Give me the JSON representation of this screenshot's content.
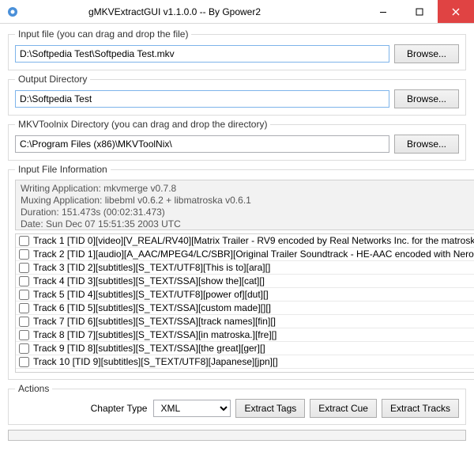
{
  "window": {
    "title": "gMKVExtractGUI v1.1.0.0 -- By Gpower2"
  },
  "input_file": {
    "legend": "Input file (you can drag and drop the file)",
    "value": "D:\\Softpedia Test\\Softpedia Test.mkv",
    "browse": "Browse..."
  },
  "output_dir": {
    "legend": "Output Directory",
    "value": "D:\\Softpedia Test",
    "browse": "Browse..."
  },
  "toolnix_dir": {
    "legend": "MKVToolnix Directory (you can drag and drop the directory)",
    "value": "C:\\Program Files (x86)\\MKVToolNix\\",
    "browse": "Browse..."
  },
  "file_info": {
    "legend": "Input File Information",
    "text": "Writing Application: mkvmerge v0.7.8\nMuxing Application: libebml v0.6.2 + libmatroska v0.6.1\nDuration: 151.473s (00:02:31.473)\nDate: Sun Dec 07 15:51:35 2003 UTC",
    "tracks": [
      "Track 1 [TID 0][video][V_REAL/RV40][Matrix Trailer - RV9 encoded by Real Networks Inc. for the matroska",
      "Track 2 [TID 1][audio][A_AAC/MPEG4/LC/SBR][Original Trailer Soundtrack - HE-AAC encoded with Nero",
      "Track 3 [TID 2][subtitles][S_TEXT/UTF8][This is to][ara][]",
      "Track 4 [TID 3][subtitles][S_TEXT/SSA][show the][cat][]",
      "Track 5 [TID 4][subtitles][S_TEXT/UTF8][power of][dut][]",
      "Track 6 [TID 5][subtitles][S_TEXT/SSA][custom made][][]",
      "Track 7 [TID 6][subtitles][S_TEXT/SSA][track names][fin][]",
      "Track 8 [TID 7][subtitles][S_TEXT/SSA][in matroska.][fre][]",
      "Track 9 [TID 8][subtitles][S_TEXT/SSA][the great][ger][]",
      "Track 10 [TID 9][subtitles][S_TEXT/UTF8][Japanese][jpn][]"
    ]
  },
  "actions": {
    "legend": "Actions",
    "chapter_label": "Chapter Type",
    "chapter_value": "XML",
    "extract_tags": "Extract Tags",
    "extract_cue": "Extract Cue",
    "extract_tracks": "Extract Tracks"
  }
}
